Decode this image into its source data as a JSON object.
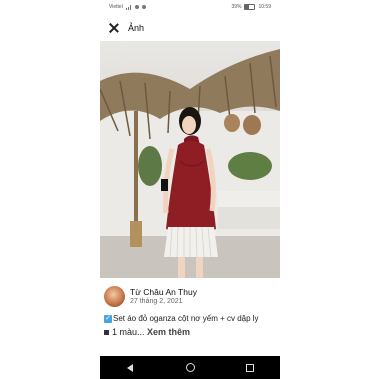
{
  "status_bar": {
    "carrier": "Viettel",
    "battery": "39%",
    "time": "10:59"
  },
  "header": {
    "title": "Ảnh"
  },
  "post": {
    "author": "Từ Châu An Thuy",
    "date": "27 tháng 2, 2021",
    "caption_line1": "Set áo đỏ oganza cột nơ yếm + cv dập ly",
    "caption_line2_prefix": "1 màu...",
    "see_more": "Xem thêm"
  },
  "colors": {
    "dress": "#8e1d24",
    "skirt": "#f2f0ec",
    "nav_bar": "#000000"
  }
}
